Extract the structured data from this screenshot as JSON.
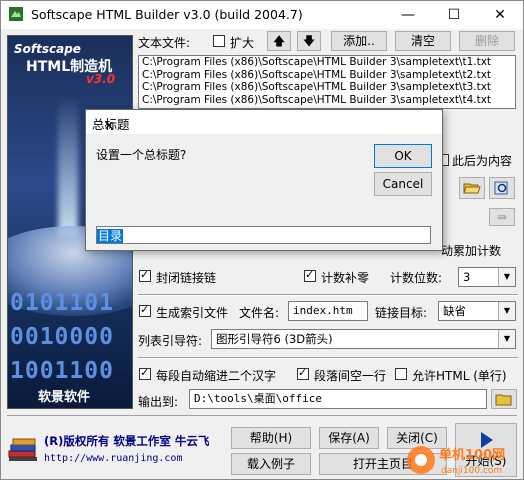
{
  "window": {
    "title": "Softscape HTML Builder v3.0 (build 2004.7)",
    "minimize": "—",
    "maximize": "☐",
    "close": "✕"
  },
  "left_panel": {
    "logo_brand": "Softscape",
    "logo_product": "HTML制造机",
    "logo_version": "v3.0",
    "binary_lines": [
      "0101101",
      "0010000",
      "1001100"
    ],
    "brand_name": "软景软件"
  },
  "files": {
    "label": "文本文件:",
    "expand_label": "扩大",
    "expand_checked": false,
    "up_icon": "arrow-up",
    "down_icon": "arrow-down",
    "add_label": "添加..",
    "clear_label": "清空",
    "delete_label": "删除",
    "items": [
      "C:\\Program Files (x86)\\Softscape\\HTML Builder 3\\sampletext\\t1.txt",
      "C:\\Program Files (x86)\\Softscape\\HTML Builder 3\\sampletext\\t2.txt",
      "C:\\Program Files (x86)\\Softscape\\HTML Builder 3\\sampletext\\t3.txt",
      "C:\\Program Files (x86)\\Softscape\\HTML Builder 3\\sampletext\\t4.txt"
    ]
  },
  "partial": {
    "after_content_label": "此后为内容",
    "auto_count_label": "动累加计数"
  },
  "options": {
    "close_link_chain_label": "封闭链接链",
    "close_link_chain_checked": true,
    "count_pad_zero_label": "计数补零",
    "count_pad_zero_checked": true,
    "count_digits_label": "计数位数:",
    "count_digits_value": "3",
    "gen_index_label": "生成索引文件",
    "gen_index_checked": true,
    "filename_label": "文件名:",
    "filename_value": "index.htm",
    "link_target_label": "链接目标:",
    "link_target_value": "缺省",
    "list_guide_label": "列表引导符:",
    "list_guide_value": "图形引导符6 (3D箭头)",
    "auto_indent_label": "每段自动缩进二个汉字",
    "auto_indent_checked": true,
    "para_blank_label": "段落间空一行",
    "para_blank_checked": true,
    "allow_html_label": "允许HTML (单行)",
    "allow_html_checked": false,
    "output_label": "输出到:",
    "output_value": "D:\\tools\\桌面\\office"
  },
  "footer": {
    "copyright": "(R)版权所有 软景工作室 牛云飞",
    "url": "http://www.ruanjing.com",
    "help_label": "帮助(H)",
    "save_label": "保存(A)",
    "close_label": "关闭(C)",
    "load_example_label": "载入例子",
    "open_main_label": "打开主页目",
    "start_label": "开始(S)",
    "watermark_text": "单机100网",
    "watermark_sub": "danji100.com"
  },
  "dialog": {
    "title": "总标题",
    "close": "✕",
    "prompt": "设置一个总标题?",
    "ok_label": "OK",
    "cancel_label": "Cancel",
    "input_value": "目录"
  }
}
